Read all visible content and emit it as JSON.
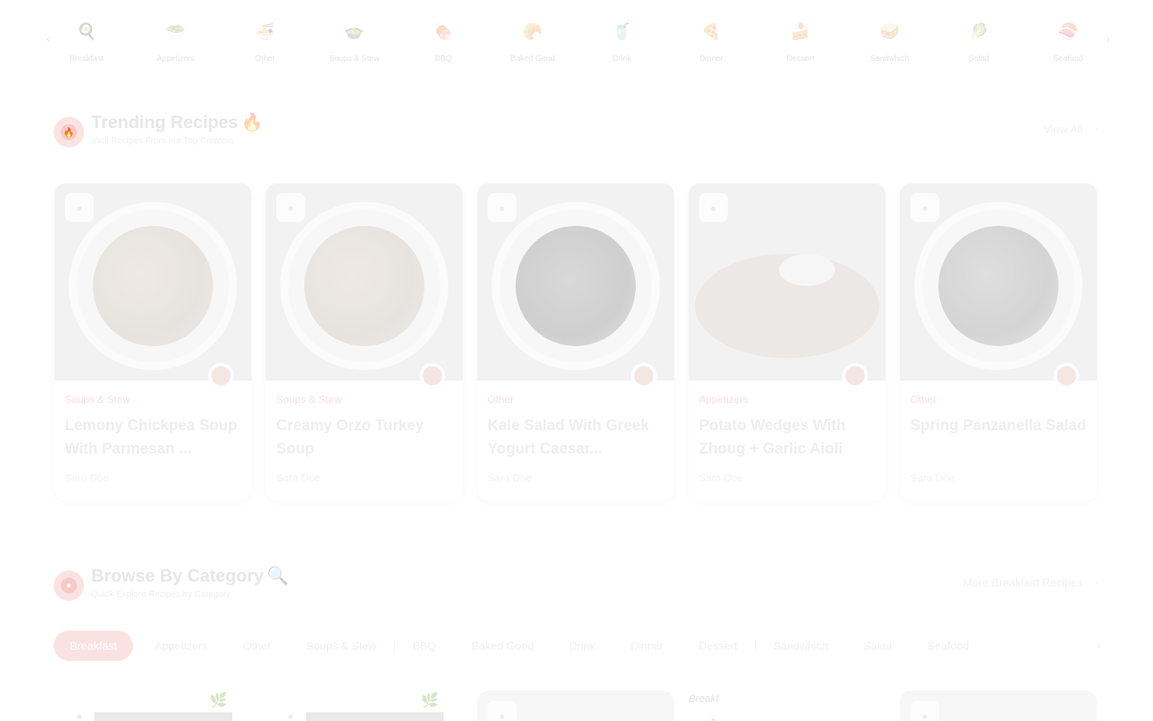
{
  "category_strip": {
    "prev_icon": "chevron-left-icon",
    "next_icon": "chevron-right-icon",
    "items": [
      {
        "label": "Breakfast",
        "icon": "breakfast-icon",
        "glyph": "🍳"
      },
      {
        "label": "Appetizers",
        "icon": "appetizers-icon",
        "glyph": "🥗"
      },
      {
        "label": "Other",
        "icon": "other-icon",
        "glyph": "🍜"
      },
      {
        "label": "Soups & Stew",
        "icon": "soup-icon",
        "glyph": "🍲"
      },
      {
        "label": "BBQ",
        "icon": "bbq-icon",
        "glyph": "🍖"
      },
      {
        "label": "Baked Good",
        "icon": "baked-good-icon",
        "glyph": "🥐"
      },
      {
        "label": "Drink",
        "icon": "drink-icon",
        "glyph": "🥤"
      },
      {
        "label": "Dinner",
        "icon": "dinner-icon",
        "glyph": "🍕"
      },
      {
        "label": "Dessert",
        "icon": "dessert-icon",
        "glyph": "🍰"
      },
      {
        "label": "Sandwhich",
        "icon": "sandwich-icon",
        "glyph": "🥪"
      },
      {
        "label": "Salad",
        "icon": "salad-icon",
        "glyph": "🥬"
      },
      {
        "label": "Seafood",
        "icon": "seafood-icon",
        "glyph": "🍣"
      }
    ]
  },
  "trending": {
    "title": "Trending Recipes",
    "title_emoji": "🔥",
    "subtitle": "Viral Recipes From our Top Creators",
    "view_all": "View All",
    "badge_icon": "fire-icon",
    "cards": [
      {
        "category": "Soups & Stew",
        "title": "Lemony Chickpea Soup With Parmesan ...",
        "author": "Sara Doe",
        "style": "soup"
      },
      {
        "category": "Soups & Stew",
        "title": "Creamy Orzo Turkey Soup",
        "author": "Sara Doe",
        "style": "soup"
      },
      {
        "category": "Other",
        "title": "Kale Salad With Greek Yogurt Caesar...",
        "author": "Sara Doe",
        "style": "dark"
      },
      {
        "category": "Appetizers",
        "title": "Potato Wedges With Zhoug + Garlic Aioli",
        "author": "Sara Doe",
        "style": "tart"
      },
      {
        "category": "Other",
        "title": "Spring Panzanella Salad",
        "author": "Sara Doe",
        "style": "salad"
      }
    ]
  },
  "browse": {
    "title": "Browse By Category",
    "title_emoji": "🔍",
    "subtitle": "Quick Explore Recipes by Category",
    "more_link": "More Breakfast Recipes",
    "badge_icon": "category-icon",
    "pills": [
      "Breakfast",
      "Appetizers",
      "Other",
      "Soups & Stew",
      "BBQ",
      "Baked Good",
      "Drink",
      "Dinner",
      "Dessert",
      "Sandwhich",
      "Salad",
      "Seafood"
    ],
    "active_pill": "Breakfast",
    "card_script_text": "Breakf"
  }
}
